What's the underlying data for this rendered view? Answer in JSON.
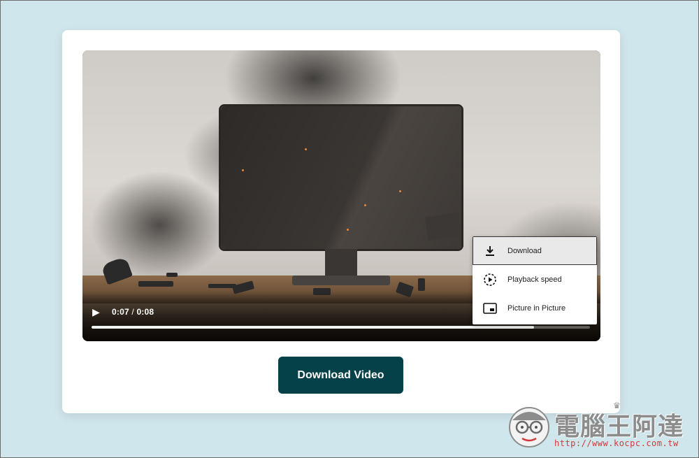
{
  "player": {
    "current_time": "0:07",
    "separator": " / ",
    "duration": "0:08",
    "progress_fraction": 0.8875
  },
  "menu": {
    "items": [
      {
        "label": "Download",
        "icon": "download-icon",
        "active": true
      },
      {
        "label": "Playback speed",
        "icon": "playback-speed-icon",
        "active": false
      },
      {
        "label": "Picture in Picture",
        "icon": "picture-in-picture-icon",
        "active": false
      }
    ]
  },
  "download_button": {
    "label": "Download Video"
  },
  "watermark": {
    "title": "電腦王阿達",
    "url": "http://www.kocpc.com.tw"
  },
  "colors": {
    "background": "#cfe6ec",
    "button": "#054148",
    "watermark_url": "#d23a3a"
  }
}
